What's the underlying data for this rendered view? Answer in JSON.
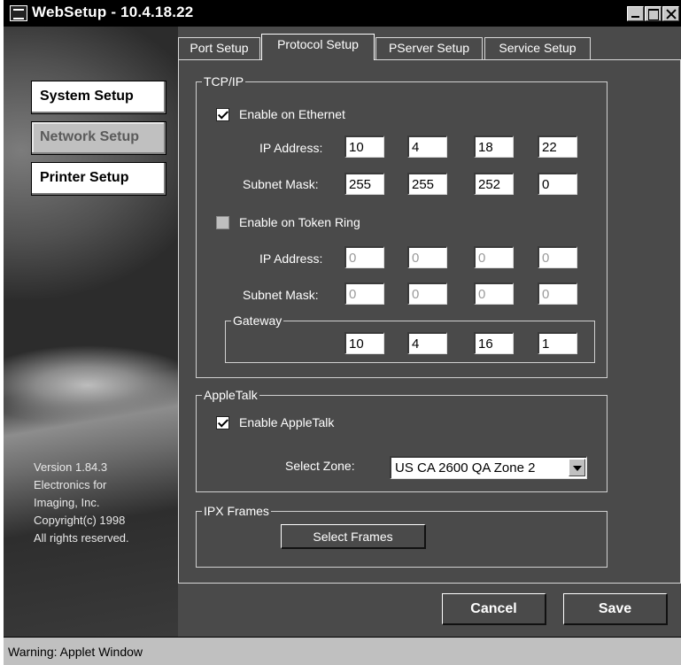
{
  "window": {
    "title": "WebSetup - 10.4.18.22"
  },
  "nav": {
    "items": [
      {
        "label": "System Setup"
      },
      {
        "label": "Network Setup"
      },
      {
        "label": "Printer Setup"
      }
    ],
    "active": "Network Setup"
  },
  "version_info": {
    "lines": [
      "Version 1.84.3",
      "Electronics for",
      "Imaging, Inc.",
      "Copyright(c) 1998",
      "All rights reserved."
    ]
  },
  "tabs": [
    {
      "label": "Port Setup"
    },
    {
      "label": "Protocol Setup"
    },
    {
      "label": "PServer Setup"
    },
    {
      "label": "Service Setup"
    }
  ],
  "active_tab": "Protocol Setup",
  "tcpip": {
    "legend": "TCP/IP",
    "ethernet": {
      "label": "Enable on Ethernet",
      "checked": true,
      "ip_label": "IP Address:",
      "ip": [
        "10",
        "4",
        "18",
        "22"
      ],
      "mask_label": "Subnet Mask:",
      "mask": [
        "255",
        "255",
        "252",
        "0"
      ]
    },
    "token_ring": {
      "label": "Enable on Token Ring",
      "checked": false,
      "ip_label": "IP Address:",
      "ip": [
        "0",
        "0",
        "0",
        "0"
      ],
      "mask_label": "Subnet Mask:",
      "mask": [
        "0",
        "0",
        "0",
        "0"
      ]
    },
    "gateway": {
      "legend": "Gateway",
      "values": [
        "10",
        "4",
        "16",
        "1"
      ]
    }
  },
  "appletalk": {
    "legend": "AppleTalk",
    "enable_label": "Enable AppleTalk",
    "checked": true,
    "zone_label": "Select Zone:",
    "zone_value": "US CA 2600 QA Zone 2"
  },
  "ipx": {
    "legend": "IPX Frames",
    "button": "Select Frames"
  },
  "buttons": {
    "cancel": "Cancel",
    "save": "Save"
  },
  "status": {
    "text": "Warning: Applet Window"
  }
}
